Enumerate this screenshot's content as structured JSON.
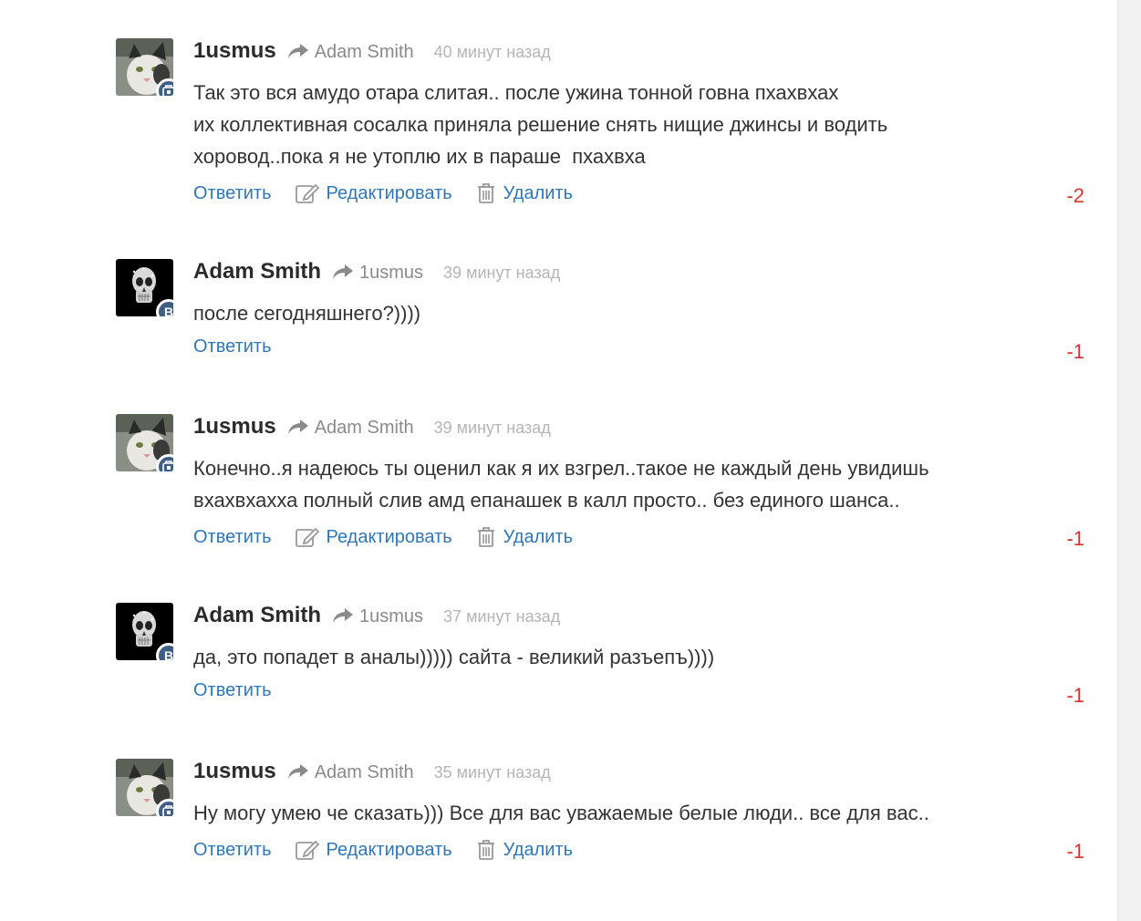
{
  "comments": [
    {
      "author": "1usmus",
      "reply_to": "Adam Smith",
      "time": "40 минут назад",
      "text": "Так это вся амудо отара слитая.. после ужина тонной говна пхахвхах\nих коллективная сосалка приняла решение снять нищие джинсы и водить\nхоровод..пока я не утоплю их в параше  пхахвха",
      "actions": {
        "reply": "Ответить",
        "edit": "Редактировать",
        "delete": "Удалить"
      },
      "score": "-2",
      "avatar_badge": "vk-icon"
    },
    {
      "author": "Adam Smith",
      "reply_to": "1usmus",
      "time": "39 минут назад",
      "text": "после сегодняшнего?))))",
      "actions": {
        "reply": "Ответить"
      },
      "score": "-1",
      "avatar_badge": "В"
    },
    {
      "author": "1usmus",
      "reply_to": "Adam Smith",
      "time": "39 минут назад",
      "text": "Конечно..я надеюсь ты оценил как я их взгрел..такое не каждый день увидишь\nвхахвхахха полный слив амд епанашек в калл просто.. без единого шанса..",
      "actions": {
        "reply": "Ответить",
        "edit": "Редактировать",
        "delete": "Удалить"
      },
      "score": "-1",
      "avatar_badge": "vk-icon"
    },
    {
      "author": "Adam Smith",
      "reply_to": "1usmus",
      "time": "37 минут назад",
      "text": "да, это попадет в аналы))))) сайта - великий разъепъ))))",
      "actions": {
        "reply": "Ответить"
      },
      "score": "-1",
      "avatar_badge": "В"
    },
    {
      "author": "1usmus",
      "reply_to": "Adam Smith",
      "time": "35 минут назад",
      "text": "Ну могу умею че сказать))) Все для вас уважаемые белые люди.. все для вас..",
      "actions": {
        "reply": "Ответить",
        "edit": "Редактировать",
        "delete": "Удалить"
      },
      "score": "-1",
      "avatar_badge": "vk-icon"
    }
  ],
  "colors": {
    "link": "#2e77b8",
    "score_negative": "#d9342b",
    "badge": "#3f5e86"
  }
}
